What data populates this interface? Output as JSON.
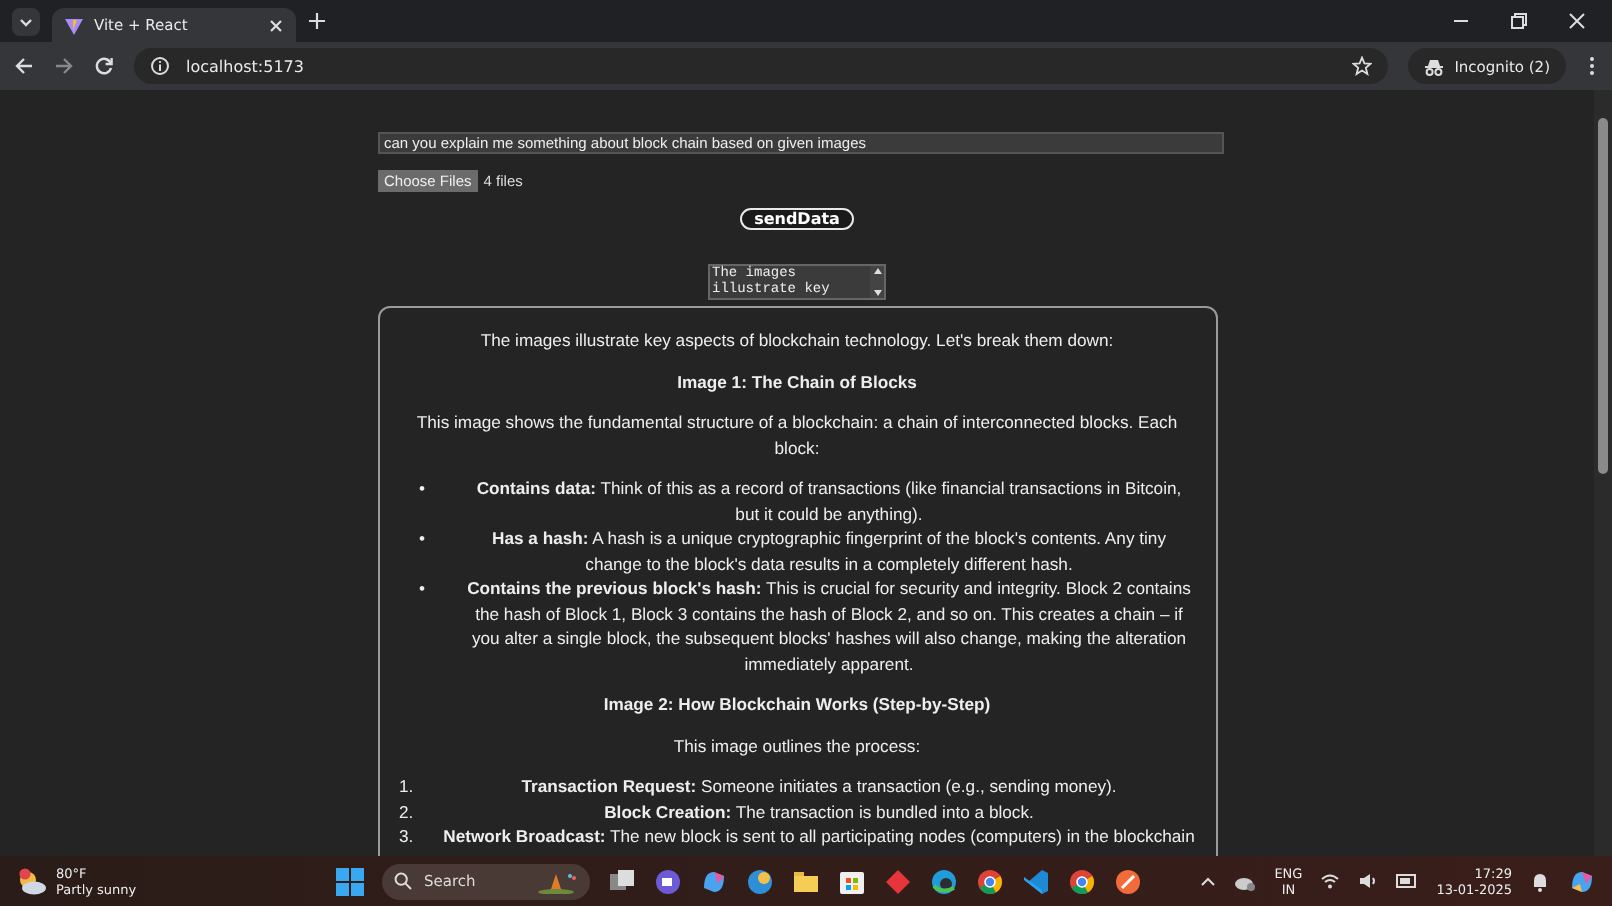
{
  "browser": {
    "tabs": [
      {
        "title": "Vite + React",
        "selected": true
      }
    ],
    "address": "localhost:5173",
    "profile": "Incognito (2)"
  },
  "page": {
    "prompt_value": "can you explain me something about block chain based on given images",
    "file_button": "Choose Files",
    "file_status": "4 files",
    "send_button": "sendData",
    "preview_value": "The images illustrate key",
    "response": [
      {
        "kind": "paragraph",
        "text": "The images illustrate key aspects of blockchain technology. Let's break them down:"
      },
      {
        "kind": "heading",
        "text": "Image 1: The Chain of Blocks"
      },
      {
        "kind": "paragraph",
        "text": "This image shows the fundamental structure of a blockchain: a chain of interconnected blocks. Each block:"
      },
      {
        "kind": "bullets",
        "items": [
          {
            "marker": "•",
            "text": "**Contains data:** Think of this as a record of transactions (like financial transactions in Bitcoin, but it could be anything)."
          },
          {
            "marker": "•",
            "text": "**Has a hash:** A hash is a unique cryptographic fingerprint of the block's contents. Any tiny change to the block's data results in a completely different hash."
          },
          {
            "marker": "•",
            "text": "**Contains the previous block's hash:** This is crucial for security and integrity. Block 2 contains the hash of Block 1, Block 3 contains the hash of Block 2, and so on. This creates a chain – if you alter a single block, the subsequent blocks' hashes will also change, making the alteration immediately apparent."
          }
        ]
      },
      {
        "kind": "heading",
        "text": "Image 2: How Blockchain Works (Step-by-Step)"
      },
      {
        "kind": "paragraph",
        "text": "This image outlines the process:"
      },
      {
        "kind": "numbered",
        "items": [
          {
            "marker": "1.",
            "text": "**Transaction Request:** Someone initiates a transaction (e.g., sending money)."
          },
          {
            "marker": "2.",
            "text": "**Block Creation:** The transaction is bundled into a block."
          },
          {
            "marker": "3.",
            "text": "**Network Broadcast:** The new block is sent to all participating nodes (computers) in the blockchain"
          }
        ]
      }
    ]
  },
  "taskbar": {
    "weather_temp": "80°F",
    "weather_text": "Partly sunny",
    "search_placeholder": "Search",
    "language": "ENG",
    "region": "IN",
    "time": "17:29",
    "date": "13-01-2025"
  }
}
